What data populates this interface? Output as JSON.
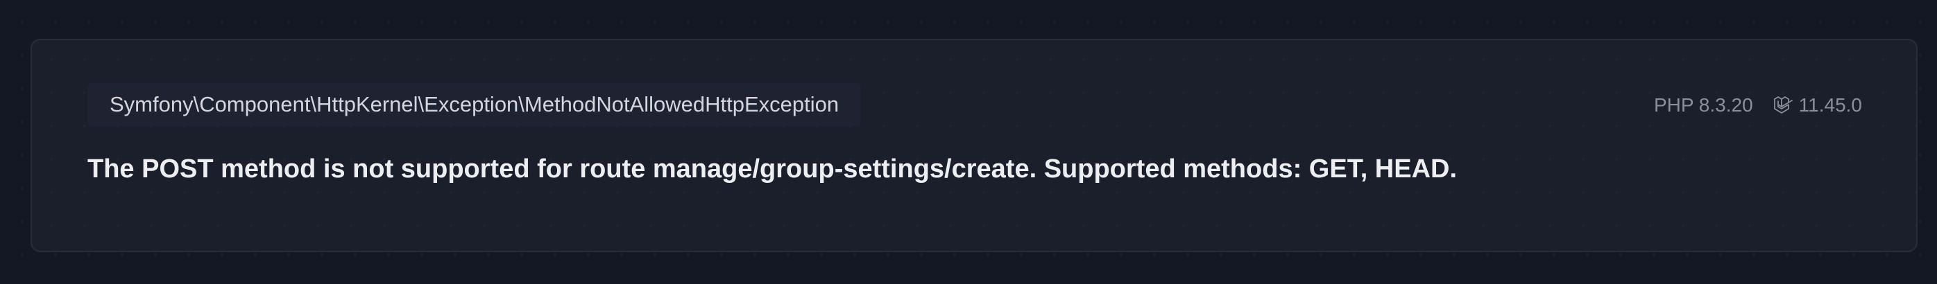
{
  "exception": {
    "class_name": "Symfony\\Component\\HttpKernel\\Exception\\MethodNotAllowedHttpException",
    "message": "The POST method is not supported for route manage/group-settings/create. Supported methods: GET, HEAD."
  },
  "meta": {
    "php_version": "PHP 8.3.20",
    "laravel_version": "11.45.0",
    "laravel_icon": "laravel-logo-icon"
  },
  "colors": {
    "page_background": "#141824",
    "card_background": "#1b1f2b",
    "card_border": "#282d3a",
    "message_text": "#eceef2",
    "class_text": "#d3d6de",
    "meta_text": "#8a8f9c"
  }
}
